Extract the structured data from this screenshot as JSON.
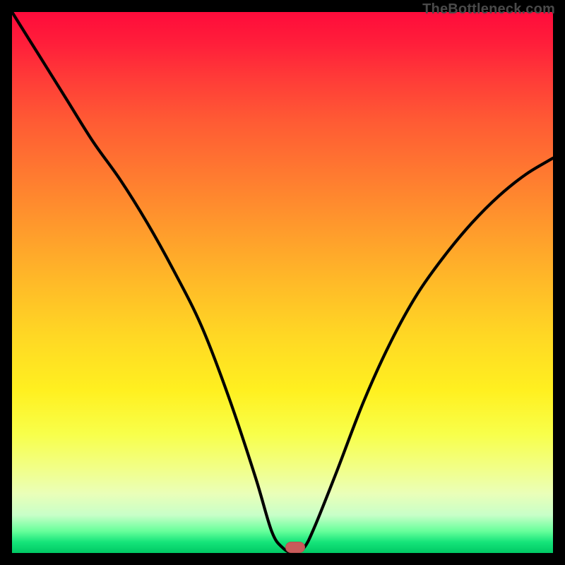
{
  "watermark": {
    "text": "TheBottleneck.com"
  },
  "marker": {
    "color": "#c95a5a",
    "x_pct": 52.3,
    "y_pct": 99.0
  },
  "chart_data": {
    "type": "line",
    "title": "",
    "xlabel": "",
    "ylabel": "",
    "xlim": [
      0,
      100
    ],
    "ylim": [
      0,
      100
    ],
    "grid": false,
    "legend": false,
    "series": [
      {
        "name": "bottleneck-curve",
        "x": [
          0,
          5,
          10,
          15,
          20,
          25,
          30,
          35,
          40,
          45,
          48,
          50,
          52,
          54,
          56,
          60,
          65,
          70,
          75,
          80,
          85,
          90,
          95,
          100
        ],
        "y": [
          100,
          92,
          84,
          76,
          69,
          61,
          52,
          42,
          29,
          14,
          4,
          1,
          0,
          1,
          5,
          15,
          28,
          39,
          48,
          55,
          61,
          66,
          70,
          73
        ]
      }
    ],
    "annotations": [
      {
        "type": "marker",
        "x": 52.3,
        "y": 1.0,
        "color": "#c95a5a",
        "shape": "pill"
      }
    ],
    "background": {
      "type": "vertical-gradient",
      "stops": [
        {
          "pct": 0,
          "color": "#ff0b3b"
        },
        {
          "pct": 50,
          "color": "#ffba28"
        },
        {
          "pct": 78,
          "color": "#f8ff4a"
        },
        {
          "pct": 96,
          "color": "#66ff9a"
        },
        {
          "pct": 100,
          "color": "#00c864"
        }
      ]
    }
  }
}
